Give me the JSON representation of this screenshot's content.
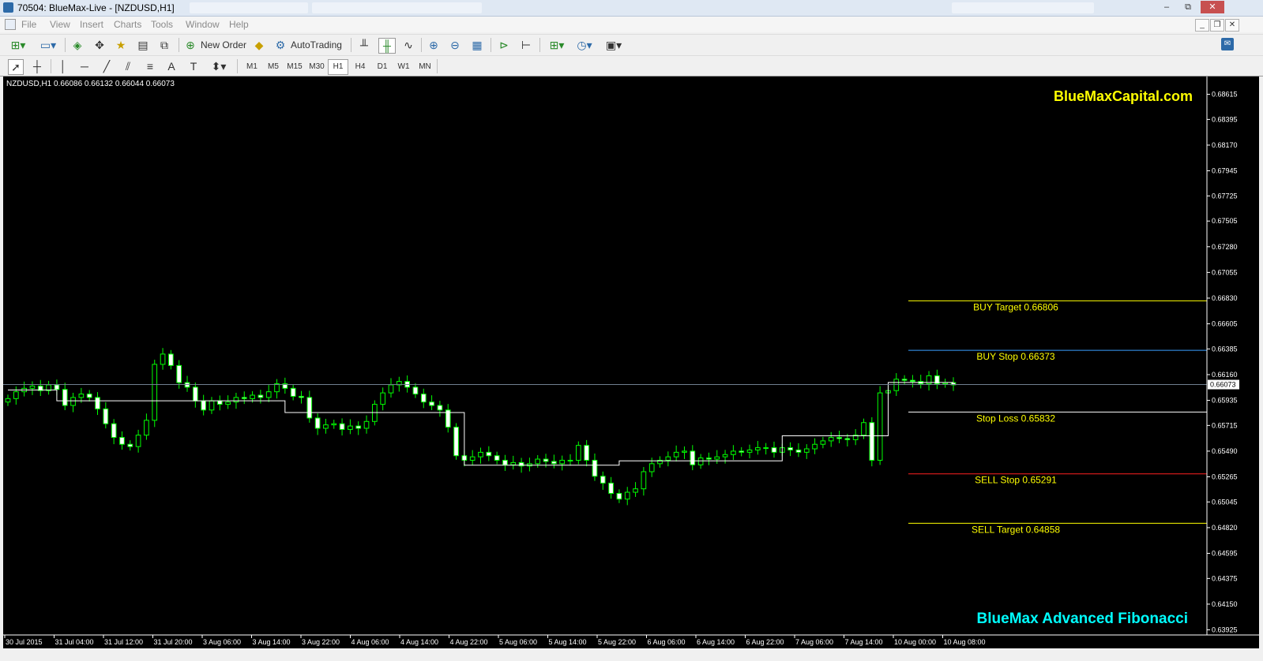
{
  "window": {
    "title": "70504: BlueMax-Live - [NZDUSD,H1]",
    "controls": [
      "‒",
      "⧉",
      "✕"
    ]
  },
  "menu": [
    "File",
    "View",
    "Insert",
    "Charts",
    "Tools",
    "Window",
    "Help"
  ],
  "toolbar": {
    "new_order": "New Order",
    "autotrading": "AutoTrading"
  },
  "timeframes": [
    "M1",
    "M5",
    "M15",
    "M30",
    "H1",
    "H4",
    "D1",
    "W1",
    "MN"
  ],
  "active_timeframe": "H1",
  "search": {
    "placeholder": ""
  },
  "chart": {
    "header": "NZDUSD,H1  0.66086 0.66132 0.66044 0.66073",
    "brand": "BlueMaxCapital.com",
    "footer_brand": "BlueMax Advanced Fibonacci",
    "current_price": "0.66073",
    "colors": {
      "bull": "#00ff00",
      "bear": "#ffffff",
      "background": "#000000",
      "brand": "#ffff00",
      "footer": "#00ffff"
    }
  },
  "chart_data": {
    "type": "candlestick",
    "symbol": "NZDUSD",
    "timeframe": "H1",
    "ohlc_current": {
      "open": 0.66086,
      "high": 0.66132,
      "low": 0.66044,
      "close": 0.66073
    },
    "y_ticks": [
      "0.68615",
      "0.68395",
      "0.68170",
      "0.67945",
      "0.67725",
      "0.67505",
      "0.67280",
      "0.67055",
      "0.66830",
      "0.66605",
      "0.66385",
      "0.66160",
      "0.65935",
      "0.65715",
      "0.65490",
      "0.65265",
      "0.65045",
      "0.64820",
      "0.64595",
      "0.64375",
      "0.64150",
      "0.63925"
    ],
    "x_ticks": [
      "30 Jul 2015",
      "31 Jul 04:00",
      "31 Jul 12:00",
      "31 Jul 20:00",
      "3 Aug 06:00",
      "3 Aug 14:00",
      "3 Aug 22:00",
      "4 Aug 06:00",
      "4 Aug 14:00",
      "4 Aug 22:00",
      "5 Aug 06:00",
      "5 Aug 14:00",
      "5 Aug 22:00",
      "6 Aug 06:00",
      "6 Aug 14:00",
      "6 Aug 22:00",
      "7 Aug 06:00",
      "7 Aug 14:00",
      "10 Aug 00:00",
      "10 Aug 08:00"
    ],
    "ylim": [
      0.6388,
      0.6875
    ],
    "levels": [
      {
        "label": "BUY Target  0.66806",
        "price": 0.66806,
        "color": "#ffff00"
      },
      {
        "label": "BUY Stop    0.66373",
        "price": 0.66373,
        "color": "#3aa0ff"
      },
      {
        "label": "Stop Loss   0.65832",
        "price": 0.65832,
        "color": "#ffffff"
      },
      {
        "label": "SELL Stop   0.65291",
        "price": 0.65291,
        "color": "#ff2020"
      },
      {
        "label": "SELL Target 0.64858",
        "price": 0.64858,
        "color": "#ffff00"
      }
    ],
    "close_series": [
      0.6595,
      0.6601,
      0.6604,
      0.6606,
      0.6602,
      0.6607,
      0.6603,
      0.6589,
      0.6596,
      0.6599,
      0.6596,
      0.6586,
      0.6573,
      0.6561,
      0.6555,
      0.6553,
      0.6563,
      0.6576,
      0.6625,
      0.6634,
      0.6624,
      0.6609,
      0.6605,
      0.6593,
      0.6585,
      0.6593,
      0.659,
      0.6592,
      0.6596,
      0.6595,
      0.6598,
      0.6596,
      0.6601,
      0.6608,
      0.6604,
      0.6597,
      0.6596,
      0.6578,
      0.6569,
      0.6572,
      0.6573,
      0.6568,
      0.6571,
      0.6569,
      0.6575,
      0.659,
      0.66,
      0.6607,
      0.661,
      0.6605,
      0.6599,
      0.6592,
      0.6589,
      0.6585,
      0.657,
      0.6545,
      0.6541,
      0.6544,
      0.6548,
      0.6545,
      0.6541,
      0.6537,
      0.6539,
      0.6536,
      0.6538,
      0.6542,
      0.654,
      0.6538,
      0.6541,
      0.6541,
      0.6554,
      0.6541,
      0.6527,
      0.6521,
      0.6512,
      0.6507,
      0.6513,
      0.6516,
      0.6531,
      0.6538,
      0.6541,
      0.6544,
      0.6548,
      0.6549,
      0.6537,
      0.6543,
      0.6542,
      0.6544,
      0.6546,
      0.6549,
      0.6548,
      0.655,
      0.6552,
      0.6552,
      0.6548,
      0.6552,
      0.655,
      0.6548,
      0.6551,
      0.6555,
      0.6558,
      0.6561,
      0.656,
      0.6559,
      0.6563,
      0.6574,
      0.6541,
      0.66,
      0.6602,
      0.6612,
      0.6611,
      0.661,
      0.6608,
      0.6615,
      0.6608,
      0.6609,
      0.6607
    ]
  }
}
